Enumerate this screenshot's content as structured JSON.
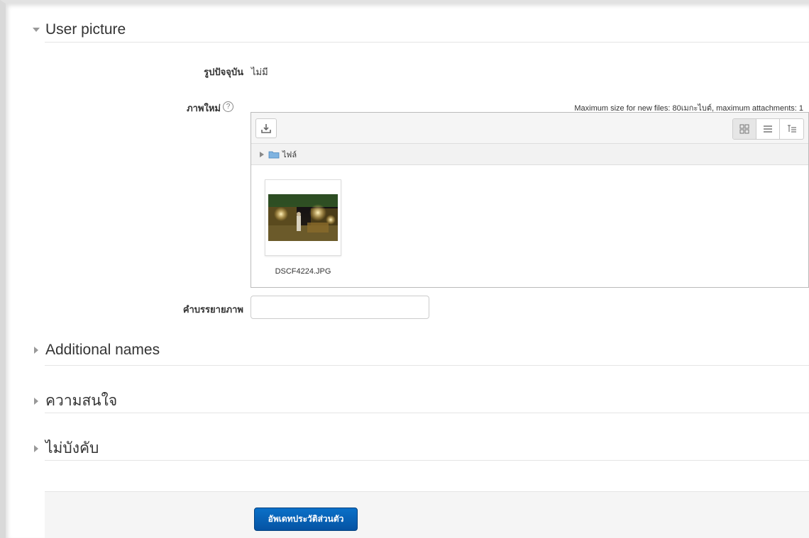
{
  "sections": {
    "user_picture": {
      "title": "User picture",
      "expanded": true
    },
    "additional_names": {
      "title": "Additional names",
      "expanded": false
    },
    "interests": {
      "title": "ความสนใจ",
      "expanded": false
    },
    "optional": {
      "title": "ไม่บังคับ",
      "expanded": false
    }
  },
  "current_picture": {
    "label": "รูปปัจจุบัน",
    "value": "ไม่มี"
  },
  "new_picture": {
    "label": "ภาพใหม่",
    "help_icon": "question-circle-icon",
    "max_info": "Maximum size for new files: 80เมกะไบต์, maximum attachments: 1"
  },
  "filepicker": {
    "add_icon": "download-icon",
    "view_icons": [
      "grid-view-icon",
      "list-view-icon",
      "tree-view-icon"
    ],
    "path_folder": "ไฟล์",
    "file": {
      "name": "DSCF4224.JPG"
    }
  },
  "image_description": {
    "label": "คำบรรยายภาพ",
    "value": ""
  },
  "submit": {
    "label": "อัพเดทประวัติส่วนตัว"
  },
  "colors": {
    "button": "#0a6ac0",
    "border": "#bbbbbb",
    "footer": "#f5f5f5"
  }
}
